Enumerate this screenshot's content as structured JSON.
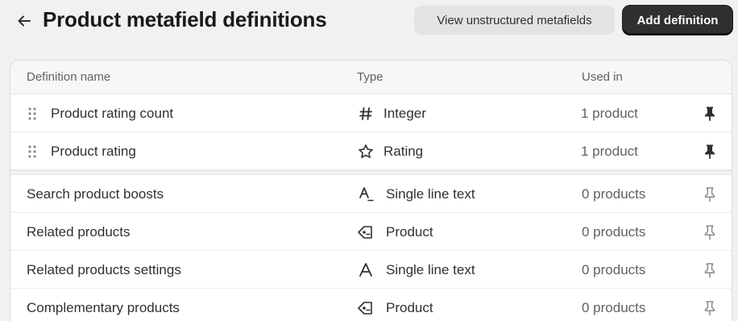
{
  "header": {
    "title": "Product metafield definitions",
    "view_unstructured_label": "View unstructured metafields",
    "add_definition_label": "Add definition"
  },
  "table": {
    "columns": [
      "Definition name",
      "Type",
      "Used in"
    ],
    "pinned_rows": [
      {
        "name": "Product rating count",
        "type": "Integer",
        "type_icon": "hash-icon",
        "used_in": "1 product",
        "pinned": true
      },
      {
        "name": "Product rating",
        "type": "Rating",
        "type_icon": "star-icon",
        "used_in": "1 product",
        "pinned": true
      }
    ],
    "rows": [
      {
        "name": "Search product boosts",
        "type": "Single line text",
        "type_icon": "text-icon",
        "used_in": "0 products",
        "pinned": false
      },
      {
        "name": "Related products",
        "type": "Product",
        "type_icon": "product-tag-icon",
        "used_in": "0 products",
        "pinned": false
      },
      {
        "name": "Related products settings",
        "type": "Single line text",
        "type_icon": "text-icon",
        "used_in": "0 products",
        "pinned": false
      },
      {
        "name": "Complementary products",
        "type": "Product",
        "type_icon": "product-tag-icon",
        "used_in": "0 products",
        "pinned": false
      }
    ]
  },
  "colors": {
    "page_bg": "#f1f1f1",
    "primary_button": "#303030",
    "secondary_button": "#e3e3e3"
  }
}
